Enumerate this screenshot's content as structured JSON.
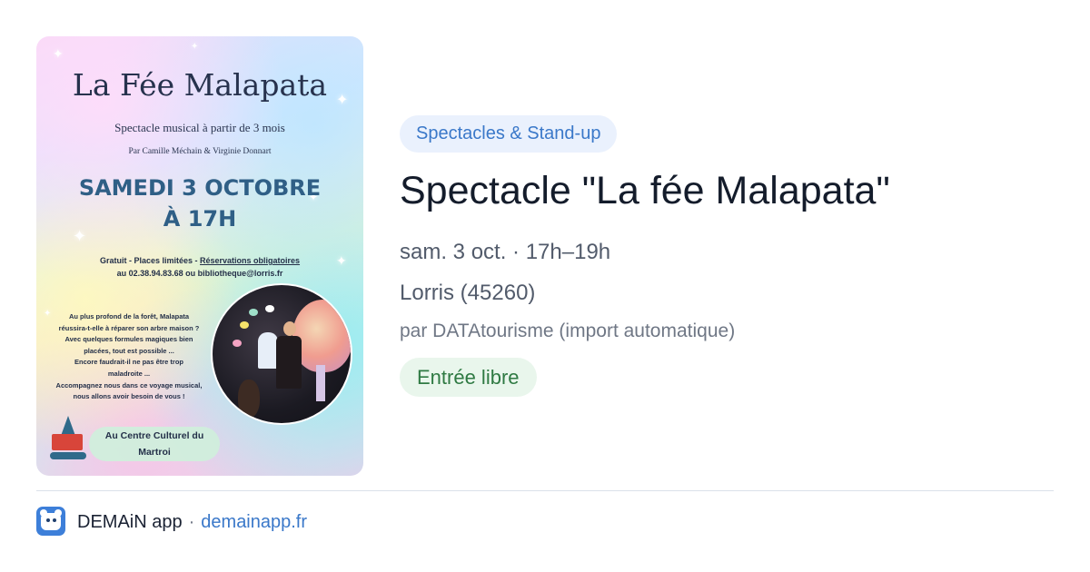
{
  "poster": {
    "title": "La Fée Malapata",
    "subtitle": "Spectacle musical à partir de 3 mois",
    "credits": "Par Camille Méchain & Virginie Donnart",
    "date_line1": "SAMEDI 3 OCTOBRE",
    "date_line2": "À 17H",
    "info_line1_a": "Gratuit - Places limitées - ",
    "info_line1_b": "Réservations obligatoires",
    "info_line2": "au 02.38.94.83.68 ou bibliotheque@lorris.fr",
    "story": [
      "Au plus profond de la forêt, Malapata",
      "réussira-t-elle à réparer son arbre maison ?",
      "Avec quelques formules magiques bien",
      "placées, tout est possible ...",
      "Encore faudrait-il ne pas être trop",
      "maladroite ...",
      "Accompagnez nous dans ce voyage musical,",
      "nous allons avoir besoin de vous !"
    ],
    "venue_line1": "Au Centre Culturel du",
    "venue_line2": "Martroi"
  },
  "event": {
    "category": "Spectacles & Stand-up",
    "title": "Spectacle \"La fée Malapata\"",
    "when": "sam. 3 oct. · 17h–19h",
    "where": "Lorris (45260)",
    "source": "par DATAtourisme (import automatique)",
    "price": "Entrée libre"
  },
  "footer": {
    "app_name": "DEMAiN app",
    "separator": "·",
    "domain": "demainapp.fr",
    "icon": "bear-face-icon"
  },
  "colors": {
    "category_bg": "#eaf1fd",
    "category_text": "#3a78c9",
    "price_bg": "#e9f6ec",
    "price_text": "#2f7a43",
    "link": "#3a78c9"
  }
}
